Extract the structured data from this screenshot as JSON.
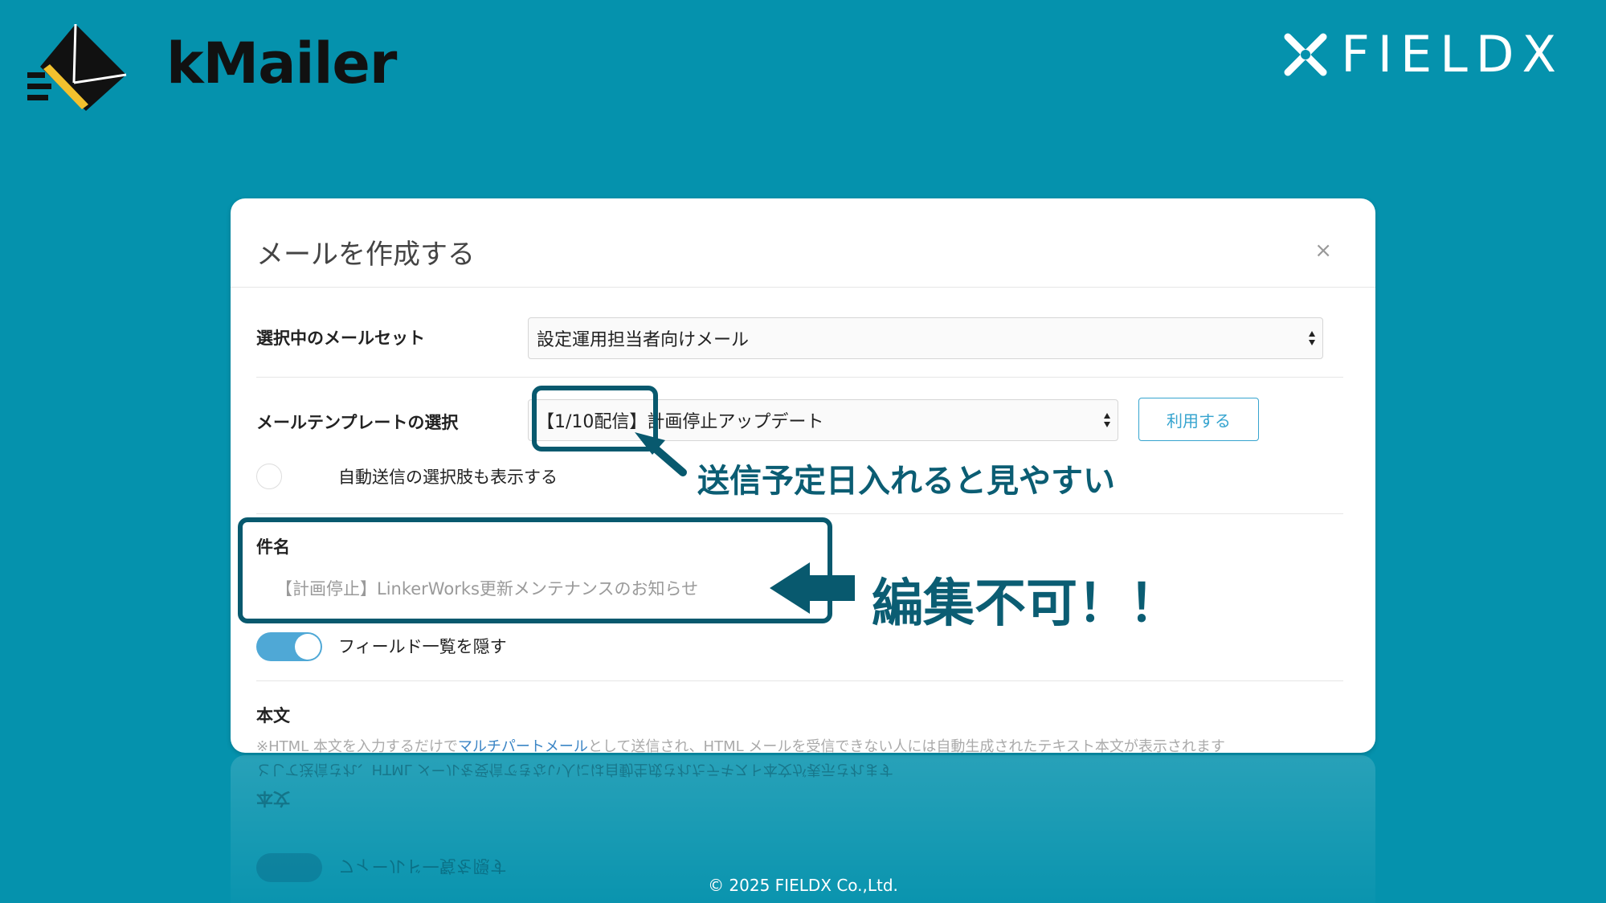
{
  "brand": {
    "name": "kMailer"
  },
  "partner": {
    "name": "FIELDX"
  },
  "modal": {
    "title": "メールを作成する",
    "close": "×",
    "mailset": {
      "label": "選択中のメールセット",
      "value": "設定運用担当者向けメール"
    },
    "template": {
      "label": "メールテンプレートの選択",
      "value": "【1/10配信】計画停止アップデート",
      "button": "利用する"
    },
    "auto_send_option": "自動送信の選択肢も表示する",
    "subject": {
      "label": "件名",
      "placeholder": "【計画停止】LinkerWorks更新メンテナンスのお知らせ"
    },
    "hide_fields_toggle": {
      "label": "フィールド一覧を隠す",
      "on": true
    },
    "body": {
      "label": "本文",
      "note_prefix": "※HTML 本文を入力するだけで",
      "note_link": "マルチパートメール",
      "note_suffix": "として送信され、HTML メールを受信できない人には自動生成されたテキスト本文が表示されます"
    }
  },
  "annotations": {
    "date_hint": "送信予定日入れると見やすい",
    "not_editable": "編集不可！！"
  },
  "footer": "© 2025 FIELDX Co.,Ltd.",
  "colors": {
    "background": "#0592ad",
    "highlight": "#08596e",
    "accent_yellow": "#f2c12e",
    "button_blue": "#36a4cf"
  }
}
